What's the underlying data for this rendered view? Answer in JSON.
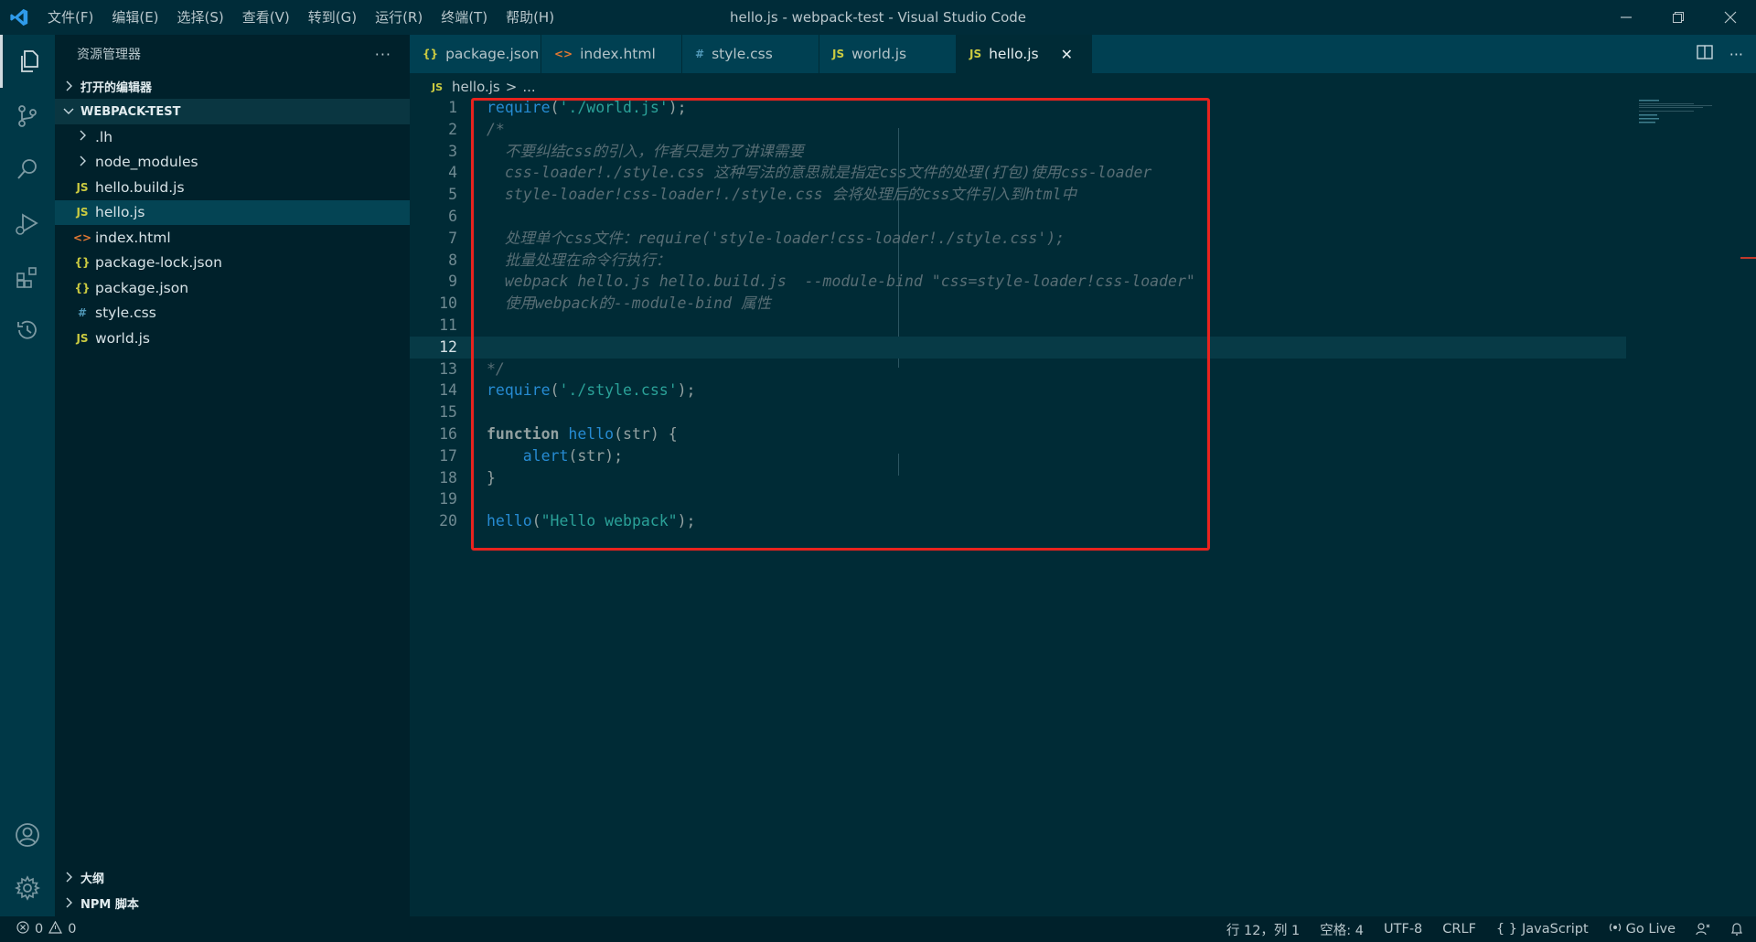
{
  "titlebar": {
    "title": "hello.js - webpack-test - Visual Studio Code",
    "menu": [
      "文件(F)",
      "编辑(E)",
      "选择(S)",
      "查看(V)",
      "转到(G)",
      "运行(R)",
      "终端(T)",
      "帮助(H)"
    ]
  },
  "activity_bar": {
    "icons": [
      "explorer-icon",
      "source-control-icon",
      "search-icon",
      "run-debug-icon",
      "extensions-icon",
      "timeline-icon",
      "account-icon",
      "settings-gear-icon"
    ]
  },
  "sidebar": {
    "header": "资源管理器",
    "more": "···",
    "open_editors": "打开的编辑器",
    "project": "WEBPACK-TEST",
    "tree": [
      {
        "label": ".lh",
        "type": "folder",
        "icon": ""
      },
      {
        "label": "node_modules",
        "type": "folder",
        "icon": ""
      },
      {
        "label": "hello.build.js",
        "type": "file",
        "icon": "JS"
      },
      {
        "label": "hello.js",
        "type": "file",
        "icon": "JS"
      },
      {
        "label": "index.html",
        "type": "file",
        "icon": "<>"
      },
      {
        "label": "package-lock.json",
        "type": "file",
        "icon": "{}"
      },
      {
        "label": "package.json",
        "type": "file",
        "icon": "{}"
      },
      {
        "label": "style.css",
        "type": "file",
        "icon": "#"
      },
      {
        "label": "world.js",
        "type": "file",
        "icon": "JS"
      }
    ],
    "outline": "大纲",
    "npm_scripts": "NPM 脚本"
  },
  "tabs": [
    {
      "label": "package.json",
      "icon": "{}"
    },
    {
      "label": "index.html",
      "icon": "<>"
    },
    {
      "label": "style.css",
      "icon": "#"
    },
    {
      "label": "world.js",
      "icon": "JS"
    },
    {
      "label": "hello.js",
      "icon": "JS",
      "active": true,
      "close": "✕"
    }
  ],
  "breadcrumb": {
    "icon": "JS",
    "file": "hello.js",
    "sep": ">",
    "rest": "..."
  },
  "editor": {
    "current_line": 12,
    "lines": [
      {
        "n": "1",
        "segs": [
          [
            "kw-fn",
            "require"
          ],
          [
            "pl",
            "("
          ],
          [
            "str",
            "'./world.js'"
          ],
          [
            "pl",
            ");"
          ]
        ]
      },
      {
        "n": "2",
        "segs": [
          [
            "cm",
            "/*"
          ]
        ]
      },
      {
        "n": "3",
        "segs": [
          [
            "cm",
            "  不要纠结css的引入，作者只是为了讲课需要"
          ]
        ]
      },
      {
        "n": "4",
        "segs": [
          [
            "cm",
            "  css-loader!./style.css 这种写法的意思就是指定css文件的处理(打包)使用css-loader"
          ]
        ]
      },
      {
        "n": "5",
        "segs": [
          [
            "cm",
            "  style-loader!css-loader!./style.css 会将处理后的css文件引入到html中"
          ]
        ]
      },
      {
        "n": "6",
        "segs": []
      },
      {
        "n": "7",
        "segs": [
          [
            "cm",
            "  处理单个css文件：require('style-loader!css-loader!./style.css');"
          ]
        ]
      },
      {
        "n": "8",
        "segs": [
          [
            "cm",
            "  批量处理在命令行执行："
          ]
        ]
      },
      {
        "n": "9",
        "segs": [
          [
            "cm",
            "  webpack hello.js hello.build.js  --module-bind \"css=style-loader!css-loader\""
          ]
        ]
      },
      {
        "n": "10",
        "segs": [
          [
            "cm",
            "  使用webpack的--module-bind 属性"
          ]
        ]
      },
      {
        "n": "11",
        "segs": []
      },
      {
        "n": "12",
        "segs": []
      },
      {
        "n": "13",
        "segs": [
          [
            "cm",
            "*/"
          ]
        ]
      },
      {
        "n": "14",
        "segs": [
          [
            "kw-fn",
            "require"
          ],
          [
            "pl",
            "("
          ],
          [
            "str",
            "'./style.css'"
          ],
          [
            "pl",
            ");"
          ]
        ]
      },
      {
        "n": "15",
        "segs": []
      },
      {
        "n": "16",
        "segs": [
          [
            "kw",
            "function"
          ],
          [
            "pl",
            " "
          ],
          [
            "kw-fn",
            "hello"
          ],
          [
            "pl",
            "(str) {"
          ]
        ]
      },
      {
        "n": "17",
        "segs": [
          [
            "pl",
            "    "
          ],
          [
            "kw-fn",
            "alert"
          ],
          [
            "pl",
            "(str);"
          ]
        ]
      },
      {
        "n": "18",
        "segs": [
          [
            "pl",
            "}"
          ]
        ]
      },
      {
        "n": "19",
        "segs": []
      },
      {
        "n": "20",
        "segs": [
          [
            "kw-fn",
            "hello"
          ],
          [
            "pl",
            "("
          ],
          [
            "str",
            "\"Hello webpack\""
          ],
          [
            "pl",
            ");"
          ]
        ]
      }
    ]
  },
  "statusbar": {
    "errors": "0",
    "warnings": "0",
    "position": "行 12，列 1",
    "spaces": "空格: 4",
    "encoding": "UTF-8",
    "eol": "CRLF",
    "language": "JavaScript",
    "language_icon": "{ }",
    "go_live": "Go Live"
  },
  "colors": {
    "highlight_box": "#e8231e",
    "editor_bg": "#002b36",
    "sidebar_bg": "#00212b"
  }
}
